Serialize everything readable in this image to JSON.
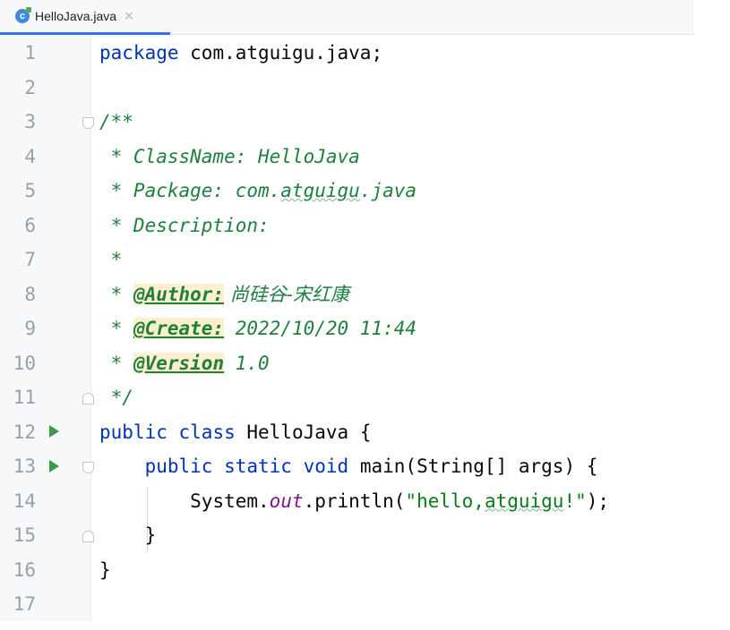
{
  "tab": {
    "icon": "java-class-icon",
    "icon_letter": "c",
    "label": "HelloJava.java",
    "close": "×"
  },
  "line_numbers": [
    "1",
    "2",
    "3",
    "4",
    "5",
    "6",
    "7",
    "8",
    "9",
    "10",
    "11",
    "12",
    "13",
    "14",
    "15",
    "16",
    "17"
  ],
  "code": {
    "l1": {
      "kw": "package",
      "rest": " com.atguigu.java;"
    },
    "l3": {
      "text": "/**"
    },
    "l4": {
      "text": " * ClassName: HelloJava"
    },
    "l5": {
      "prefix": " * Package: com.",
      "wavy": "atguigu",
      "suffix": ".java"
    },
    "l6": {
      "text": " * Description:"
    },
    "l7": {
      "text": " *"
    },
    "l8": {
      "prefix": " * ",
      "tag": "@Author:",
      "value": " 尚硅谷-宋红康"
    },
    "l9": {
      "prefix": " * ",
      "tag": "@Create:",
      "value": " 2022/10/20 11:44"
    },
    "l10": {
      "prefix": " * ",
      "tag": "@Version",
      "value": " 1.0"
    },
    "l11": {
      "text": " */"
    },
    "l12": {
      "kw1": "public",
      "kw2": "class",
      "name": " HelloJava ",
      "brace": "{"
    },
    "l13": {
      "indent": "    ",
      "kw1": "public",
      "kw2": "static",
      "kw3": "void",
      "name": " main",
      "paren_open": "(",
      "type": "String",
      "arr": "[]",
      "args": " args",
      "paren_close": ")",
      "brace": " {"
    },
    "l14": {
      "indent": "        ",
      "obj": "System.",
      "field": "out",
      "method": ".println",
      "paren_open": "(",
      "str_pre": "\"hello,",
      "str_wavy": "atguigu",
      "str_post": "!\"",
      "paren_close": ")",
      "semi": ";"
    },
    "l15": {
      "indent": "    ",
      "brace": "}"
    },
    "l16": {
      "brace": "}"
    }
  },
  "colors": {
    "keyword": "#0033b3",
    "doc_comment": "#1e7f3e",
    "string": "#067d17",
    "field": "#871094",
    "run_icon": "#3a9b47",
    "tab_underline": "#3574f0"
  }
}
